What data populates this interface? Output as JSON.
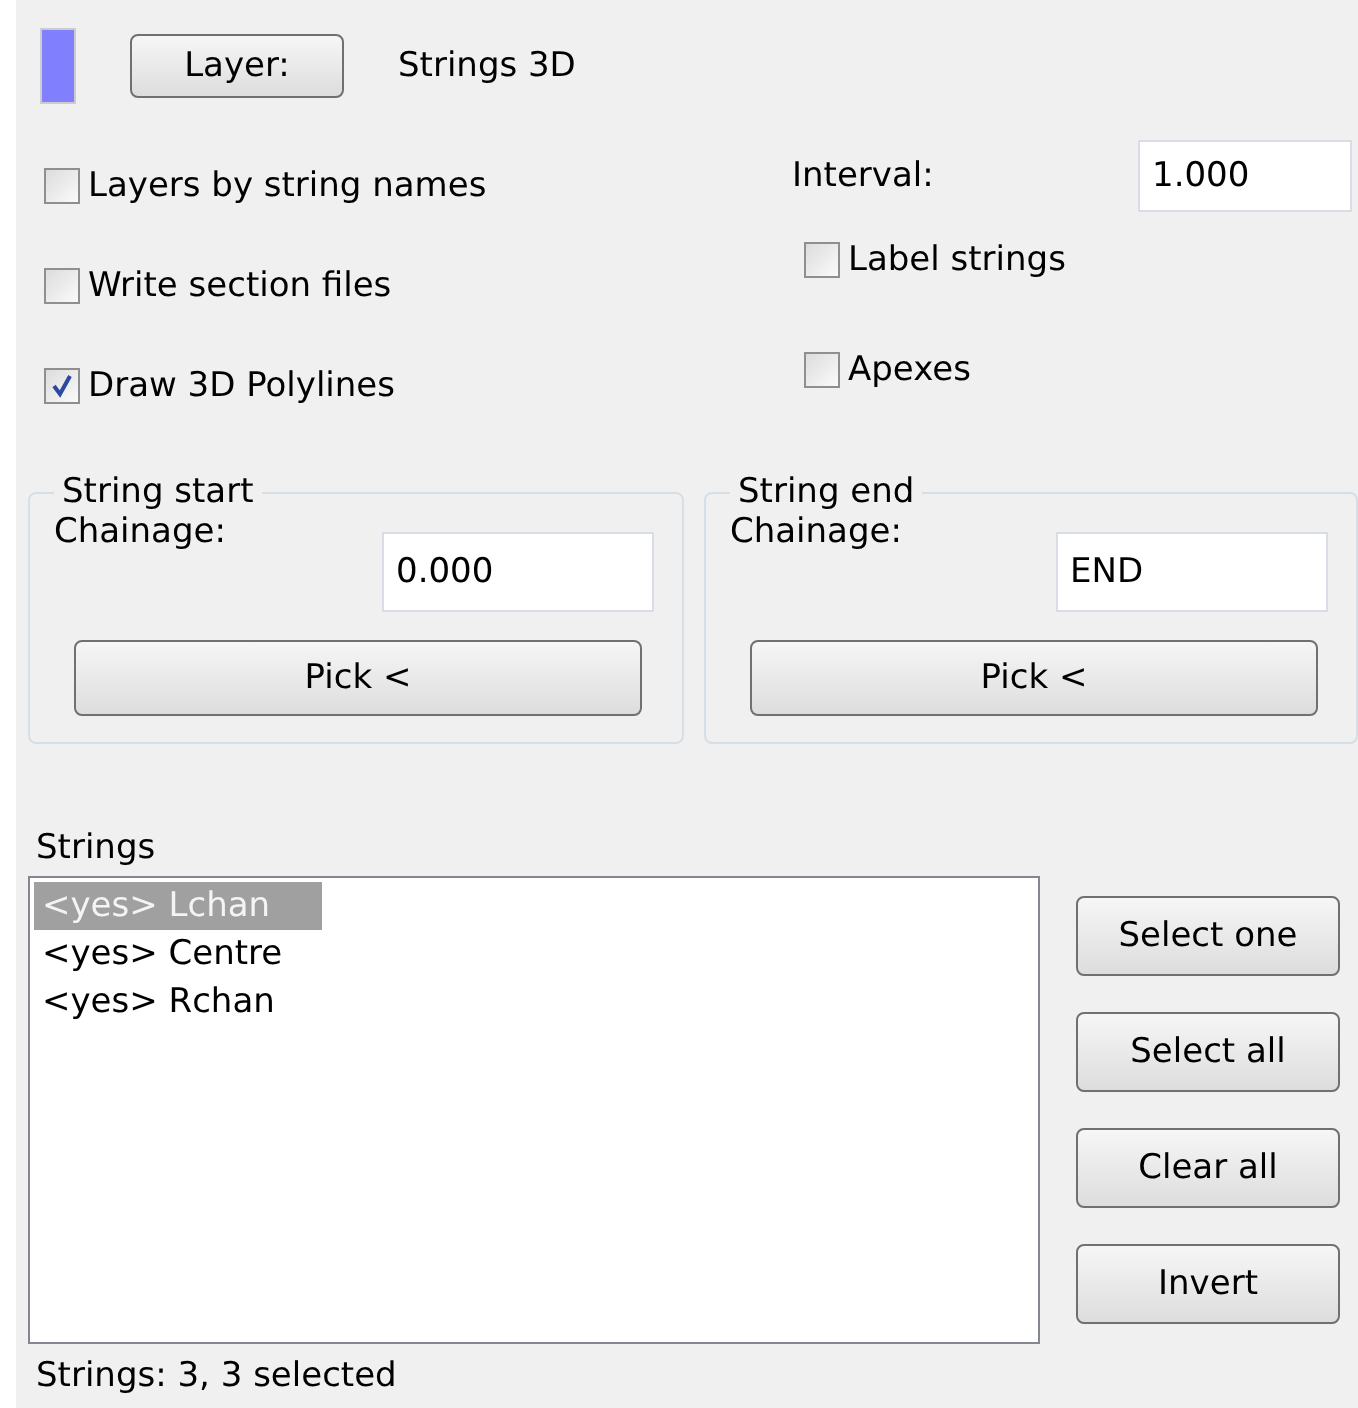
{
  "layer": {
    "color": "#8080ff",
    "button": "Layer:",
    "value": "Strings 3D"
  },
  "options": [
    {
      "label": "Layers by string names",
      "checked": false
    },
    {
      "label": "Write section files",
      "checked": false
    },
    {
      "label": "Draw 3D Polylines",
      "checked": true
    }
  ],
  "interval": {
    "label": "Interval:",
    "value": "1.000"
  },
  "right_options": [
    {
      "label": "Label strings",
      "checked": false
    },
    {
      "label": "Apexes",
      "checked": false
    }
  ],
  "groups": [
    {
      "title": "String start",
      "label": "Chainage:",
      "value": "0.000",
      "button": "Pick <"
    },
    {
      "title": "String end",
      "label": "Chainage:",
      "value": "END",
      "button": "Pick <"
    }
  ],
  "strings": {
    "label": "Strings",
    "items": [
      {
        "text": "<yes> Lchan",
        "selected": true
      },
      {
        "text": "<yes> Centre",
        "selected": false
      },
      {
        "text": "<yes> Rchan",
        "selected": false
      }
    ],
    "buttons": [
      "Select one",
      "Select all",
      "Clear all",
      "Invert"
    ],
    "status": "Strings: 3, 3 selected"
  }
}
